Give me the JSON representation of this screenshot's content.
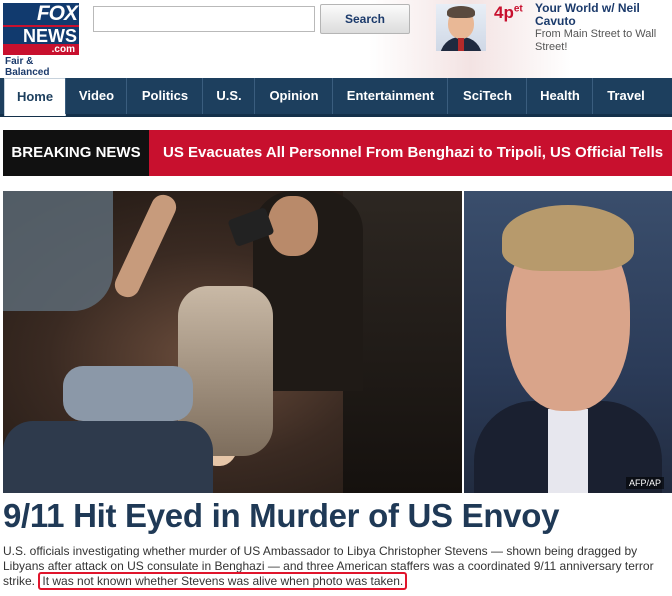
{
  "header": {
    "logo": {
      "line1": "FOX",
      "line2": "NEWS",
      "line3": ".com",
      "tagline": "Fair & Balanced"
    },
    "search": {
      "placeholder": "",
      "button_label": "Search"
    },
    "show": {
      "time": "4p",
      "time_suffix": "et",
      "title": "Your World w/ Neil Cavuto",
      "description": "From Main Street to Wall Street!"
    }
  },
  "nav": {
    "items": [
      {
        "label": "Home",
        "active": true
      },
      {
        "label": "Video"
      },
      {
        "label": "Politics"
      },
      {
        "label": "U.S."
      },
      {
        "label": "Opinion"
      },
      {
        "label": "Entertainment"
      },
      {
        "label": "SciTech"
      },
      {
        "label": "Health"
      },
      {
        "label": "Travel"
      }
    ]
  },
  "breaking": {
    "label": "BREAKING NEWS",
    "text": "US Evacuates All Personnel From Benghazi to Tripoli, US Official Tells"
  },
  "photos": {
    "credit": "AFP/AP"
  },
  "article": {
    "headline": "9/11 Hit Eyed in Murder of US Envoy",
    "summary": "U.S. officials investigating whether murder of US Ambassador to Libya Christopher Stevens — shown being dragged by Libyans after attack on US consulate in Benghazi — and three American staffers was a coordinated 9/11 anniversary terror strike.",
    "highlight": "It was not known whether Stevens was alive when photo was taken."
  },
  "colors": {
    "brand_navy": "#1d3f5e",
    "breaking_red": "#c8102e",
    "headline": "#1f3956"
  }
}
